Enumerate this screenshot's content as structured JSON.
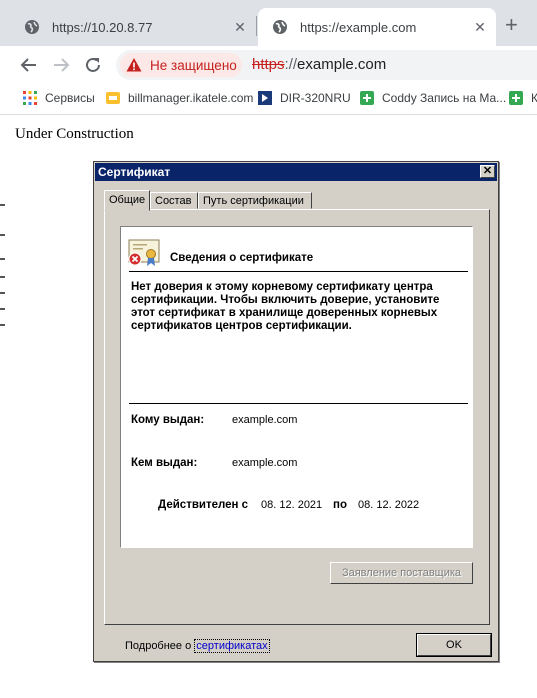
{
  "browser": {
    "tabs": [
      {
        "title": "https://10.20.8.77",
        "active": false
      },
      {
        "title": "https://example.com",
        "active": true
      }
    ],
    "security_label": "Не защищено",
    "url_scheme": "https",
    "url_sep": "://",
    "url_host": "example.com",
    "bookmarks": [
      {
        "label": "Сервисы",
        "icon": "apps-grid-icon"
      },
      {
        "label": "billmanager.ikatele.com",
        "icon": "bookmark-yellow-icon"
      },
      {
        "label": "DIR-320NRU",
        "icon": "dlink-icon"
      },
      {
        "label": "Coddy Запись на Ма...",
        "icon": "green-plus-icon"
      },
      {
        "label": "К",
        "icon": "green-plus-icon"
      }
    ]
  },
  "page": {
    "text": "Under Construction"
  },
  "dialog": {
    "title": "Сертификат",
    "tabs": [
      "Общие",
      "Состав",
      "Путь сертификации"
    ],
    "info_title": "Сведения о сертификате",
    "trust_message": "Нет доверия к этому корневому сертификату центра сертификации. Чтобы включить  доверие, установите этот сертификат в хранилище доверенных корневых сертификатов центров сертификации.",
    "issued_to_label": "Кому выдан:",
    "issued_to": "example.com",
    "issued_by_label": "Кем выдан:",
    "issued_by": "example.com",
    "valid_from_label": "Действителен с",
    "valid_from": "08. 12. 2021",
    "valid_to_label": "по",
    "valid_to": "08. 12. 2022",
    "issuer_statement_button": "Заявление поставщика",
    "learn_more_prefix": "Подробнее о ",
    "learn_more_link": "сертификатах",
    "ok_button": "OK"
  },
  "colors": {
    "dialog_titlebar": "#0a246a",
    "dialog_face": "#d4d0c8",
    "warning_red": "#c5221f",
    "link": "#0000cc"
  }
}
